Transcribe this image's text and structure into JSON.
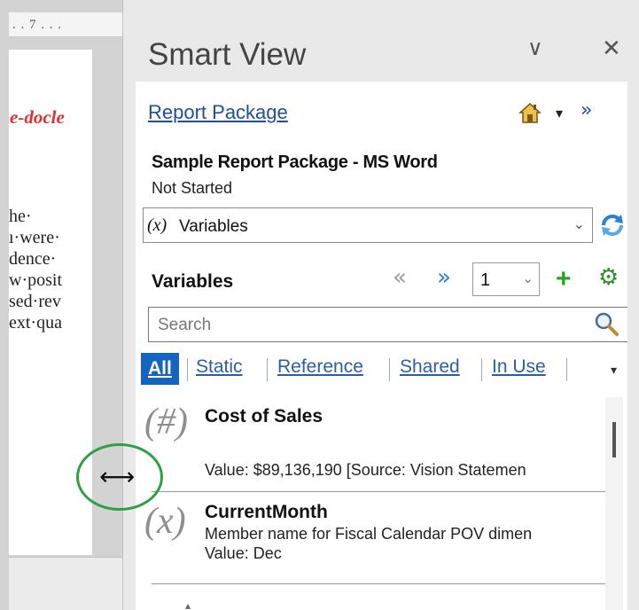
{
  "document": {
    "ruler_text": ". . 7 . . .",
    "heading_fragment": "e-docle",
    "lines": [
      "he·",
      "ı·were·",
      "dence·",
      "w·posit",
      "sed·rev",
      "ext·qua"
    ]
  },
  "panel": {
    "title": "Smart View",
    "chevron_glyph": "∨",
    "close_glyph": "✕"
  },
  "header": {
    "link_label": "Report Package",
    "dropdown_glyph": "▾",
    "more_glyph": "»"
  },
  "package": {
    "name": "Sample Report Package - MS Word",
    "status": "Not Started"
  },
  "variables_select": {
    "prefix": "(x)",
    "value": "Variables",
    "caret": "⌄"
  },
  "variables_toolbar": {
    "heading": "Variables",
    "prev_glyph": "«",
    "next_glyph": "»",
    "page_value": "1",
    "page_caret": "⌄",
    "add_glyph": "+",
    "settings_glyph": "⚙"
  },
  "search": {
    "placeholder": "Search"
  },
  "tabs": {
    "all": "All",
    "static": "Static",
    "reference": "Reference",
    "shared": "Shared",
    "in_use": "In Use",
    "scroll_glyph": "▾"
  },
  "items": [
    {
      "icon": "(#)",
      "name": "Cost of Sales",
      "line1": "Value:  $89,136,190  [Source: Vision Statemen"
    },
    {
      "icon": "(x)",
      "name": "CurrentMonth",
      "line1": "Member name for Fiscal Calendar POV dimen",
      "line2": "Value: Dec"
    }
  ],
  "resize": {
    "arrow_glyph": "⟷"
  },
  "colors": {
    "accent_blue": "#1565c0",
    "link_blue": "#1f4e9c",
    "green": "#24a424",
    "annotation_circle": "#2ea043",
    "heading_red": "#e03030"
  }
}
